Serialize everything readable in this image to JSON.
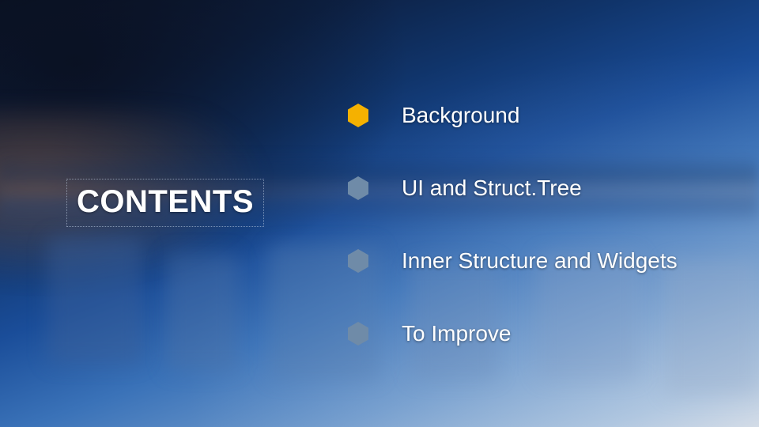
{
  "heading": "CONTENTS",
  "toc": {
    "items": [
      {
        "label": "Background",
        "active": true
      },
      {
        "label": "UI and Struct.Tree",
        "active": false
      },
      {
        "label": "Inner Structure and Widgets",
        "active": false
      },
      {
        "label": "To Improve",
        "active": false
      }
    ]
  },
  "colors": {
    "accent": "#f5b100",
    "bullet_inactive": "#6f8ba8"
  }
}
